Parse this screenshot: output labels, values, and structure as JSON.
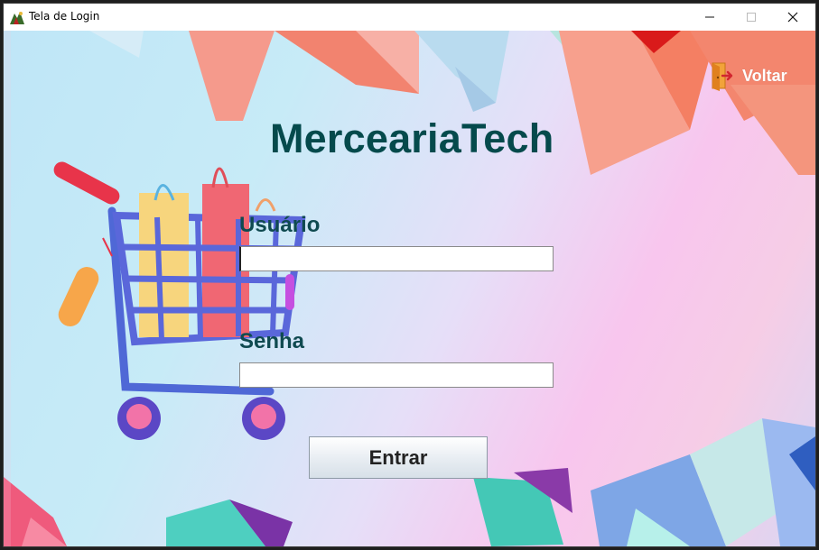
{
  "window": {
    "title": "Tela de Login"
  },
  "header": {
    "back_label": "Voltar",
    "brand": "MerceariaTech"
  },
  "form": {
    "username_label": "Usuário",
    "username_value": "",
    "password_label": "Senha",
    "password_value": "",
    "submit_label": "Entrar"
  },
  "colors": {
    "brand_text": "#054a4c",
    "label_text": "#0f4a50",
    "back_text": "#ffffff"
  },
  "icons": {
    "back": "exit-door-icon",
    "app": "app-icon",
    "illustration": "shopping-cart-icon"
  }
}
